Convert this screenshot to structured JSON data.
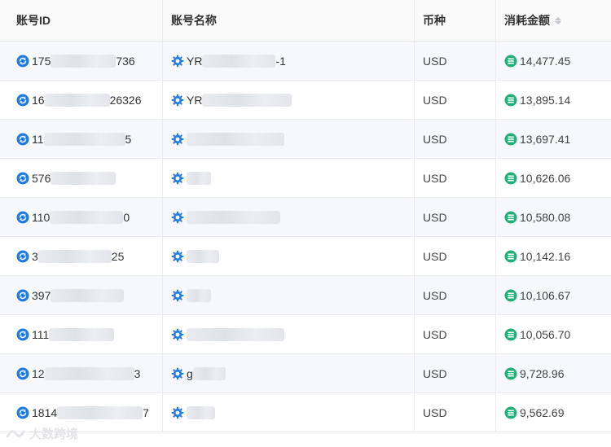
{
  "header": {
    "col_id": "账号ID",
    "col_name": "账号名称",
    "col_currency": "币种",
    "col_amount": "消耗金额"
  },
  "rows": [
    {
      "id_prefix": "175",
      "id_suffix": "736",
      "name_prefix": "YR",
      "name_suffix": "-1",
      "currency": "USD",
      "amount": "14,477.45"
    },
    {
      "id_prefix": "16",
      "id_suffix": "26326",
      "name_prefix": "YR",
      "name_suffix": "",
      "currency": "USD",
      "amount": "13,895.14"
    },
    {
      "id_prefix": "11",
      "id_suffix": "5",
      "name_prefix": "",
      "name_suffix": "",
      "currency": "USD",
      "amount": "13,697.41"
    },
    {
      "id_prefix": "576",
      "id_suffix": "",
      "name_prefix": "",
      "name_suffix": "",
      "currency": "USD",
      "amount": "10,626.06"
    },
    {
      "id_prefix": "110",
      "id_suffix": "0",
      "name_prefix": "",
      "name_suffix": "",
      "currency": "USD",
      "amount": "10,580.08"
    },
    {
      "id_prefix": "3",
      "id_suffix": "25",
      "name_prefix": "",
      "name_suffix": "",
      "currency": "USD",
      "amount": "10,142.16"
    },
    {
      "id_prefix": "397",
      "id_suffix": "",
      "name_prefix": "",
      "name_suffix": "",
      "currency": "USD",
      "amount": "10,106.67"
    },
    {
      "id_prefix": "111",
      "id_suffix": "",
      "name_prefix": "",
      "name_suffix": "",
      "currency": "USD",
      "amount": "10,056.70"
    },
    {
      "id_prefix": "12",
      "id_suffix": "3",
      "name_prefix": "g",
      "name_suffix": "",
      "currency": "USD",
      "amount": "9,728.96"
    },
    {
      "id_prefix": "1814",
      "id_suffix": "7",
      "name_prefix": "",
      "name_suffix": "",
      "currency": "USD",
      "amount": "9,562.69"
    }
  ],
  "watermark": "大数跨境",
  "icons": {
    "id_icon": "refresh-circle-icon",
    "name_icon": "gear-icon",
    "amount_icon": "coin-stack-icon",
    "sort_icon": "sort-caret-icon"
  },
  "colors": {
    "id_icon": "#1e7be6",
    "name_icon": "#2b7de0",
    "amount_icon": "#20b07a"
  }
}
